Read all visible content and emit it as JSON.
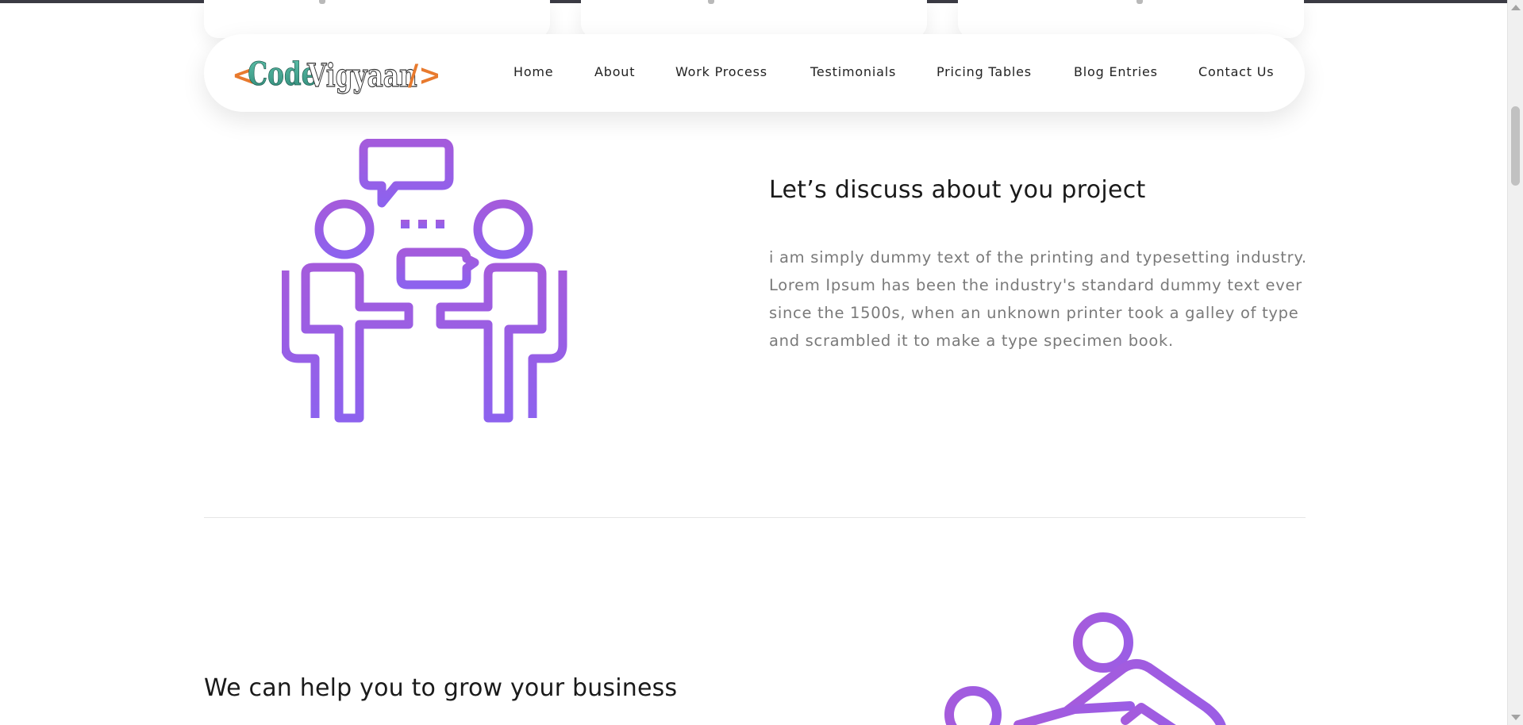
{
  "brand": {
    "logo_text_code": "Code",
    "logo_text_vigyaan": "Vigyaan",
    "logo_left_bracket": "<",
    "logo_right_bracket": "/>"
  },
  "nav": {
    "items": [
      {
        "label": "Home"
      },
      {
        "label": "About"
      },
      {
        "label": "Work Process"
      },
      {
        "label": "Testimonials"
      },
      {
        "label": "Pricing Tables"
      },
      {
        "label": "Blog Entries"
      },
      {
        "label": "Contact Us"
      }
    ]
  },
  "section_discuss": {
    "title": "Let’s discuss about you project",
    "body": "i am simply dummy text of the printing and typesetting industry. Lorem Ipsum has been the industry's standard dummy text ever since the 1500s, when an unknown printer took a galley of type and scrambled it to make a type specimen book.",
    "illustration_icon": "meeting-discussion-icon"
  },
  "section_grow": {
    "title": "We can help you to grow your business",
    "illustration_icon": "teamwork-growth-icon"
  },
  "colors": {
    "accent_purple": "#9b5de5",
    "logo_teal": "#3a9e8a",
    "logo_orange": "#e87a2e",
    "text_dark": "#1a1a1a",
    "text_muted": "#7a7a7a"
  }
}
